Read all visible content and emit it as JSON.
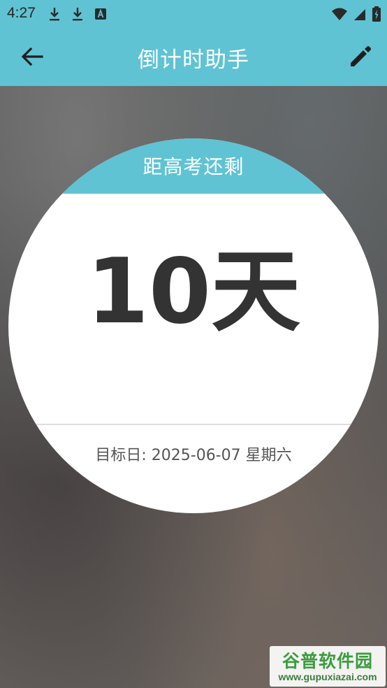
{
  "status_bar": {
    "time": "4:27",
    "left_icons": [
      "download-icon",
      "download-icon",
      "a-notification-icon"
    ],
    "right_icons": [
      "wifi-icon",
      "signal-icon",
      "battery-icon"
    ]
  },
  "app_bar": {
    "title": "倒计时助手",
    "back_icon": "arrow-left-icon",
    "edit_icon": "pencil-icon",
    "color": "#5fc3d3"
  },
  "countdown": {
    "header": "距高考还剩",
    "value": "10天",
    "target_date": "目标日: 2025-06-07 星期六",
    "text_color": "#333333"
  },
  "watermark": {
    "title": "谷普软件园",
    "url": "www.gupuxiazai.com"
  }
}
